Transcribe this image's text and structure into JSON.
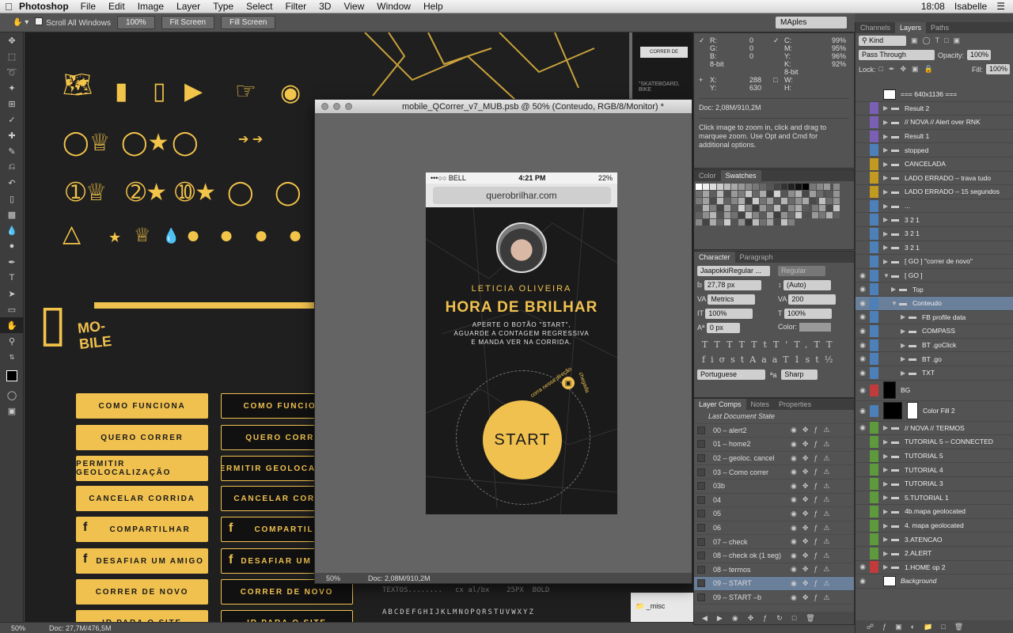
{
  "menubar": {
    "app": "Photoshop",
    "items": [
      "File",
      "Edit",
      "Image",
      "Layer",
      "Type",
      "Select",
      "Filter",
      "3D",
      "View",
      "Window",
      "Help"
    ],
    "time": "18:08",
    "user": "Isabelle"
  },
  "options": {
    "scroll_all": "Scroll All Windows",
    "zoom_btn": "100%",
    "fit_btn": "Fit Screen",
    "fill_btn": "Fill Screen",
    "workspace": "MAples"
  },
  "canvas": {
    "mobile_label": "MO-\nBILE",
    "status_zoom": "50%",
    "status_doc": "Doc: 27,7M/476,5M",
    "buttons_yellow": [
      "COMO FUNCIONA",
      "QUERO CORRER",
      "PERMITIR GEOLOCALIZAÇÃO",
      "CANCELAR CORRIDA",
      "COMPARTILHAR",
      "DESAFIAR UM AMIGO",
      "CORRER DE NOVO",
      "IR PARA O SITE"
    ],
    "buttons_dark": [
      "COMO FUNCIONA",
      "QUERO CORRER",
      "PERMITIR GEOLOCALIZAÇÃO",
      "CANCELAR CORRIDA",
      "COMPARTILHAR",
      "DESAFIAR UM AMIGO",
      "CORRER DE NOVO",
      "IR PARA O SITE"
    ],
    "textos_line": "TEXTOS........   cx al/bx    25PX  BOLD",
    "alphabet": "ABCDEFGHIJKLMNOPQRSTUVWXYZ",
    "thumb_button": "CORRER DE",
    "thumb_caption": "\"SKATEBOARD, BIKE",
    "misc_folder": "_misc"
  },
  "document": {
    "title": "mobile_QCorrer_v7_MUB.psb @ 50% (Conteudo, RGB/8/Monitor) *",
    "zoom": "50%",
    "doc": "Doc: 2,08M/910,2M"
  },
  "phone": {
    "carrier": "•••○○ BELL",
    "time": "4:21 PM",
    "battery": "22%",
    "url": "querobrilhar.com",
    "name": "LETICIA OLIVEIRA",
    "headline": "HORA DE BRILHAR",
    "body": "APERTE O BOTÃO \"START\",\nAGUARDE A CONTAGEM REGRESSIVA\nE MANDA VER NA CORRIDA.",
    "start": "START",
    "arc1": "corra nessa direção",
    "arc2": "chegada"
  },
  "info_panel": {
    "r": "R:",
    "g": "G:",
    "b": "B:",
    "r_val": "0",
    "g_val": "0",
    "b_val": "0",
    "bit": "8-bit",
    "c": "C:",
    "m": "M:",
    "y": "Y:",
    "k": "K:",
    "c_val": "99%",
    "m_val": "95%",
    "y_val": "96%",
    "k_val": "92%",
    "bit2": "8-bit",
    "x": "X:",
    "yy": "Y:",
    "x_val": "288",
    "y_val2": "630",
    "w": "W:",
    "h": "H:",
    "doc": "Doc: 2,08M/910,2M",
    "hint": "Click image to zoom in, click and drag to marquee zoom.  Use Opt and Cmd for additional options."
  },
  "swatches_panel": {
    "tab_color": "Color",
    "tab_swatches": "Swatches"
  },
  "character_panel": {
    "tab_char": "Character",
    "tab_para": "Paragraph",
    "font": "JaapokkiRegular ...",
    "style": "Regular",
    "size": "27,78 px",
    "leading": "(Auto)",
    "kerning": "Metrics",
    "tracking": "200",
    "vscale": "100%",
    "hscale": "100%",
    "baseline": "0 px",
    "color_label": "Color:",
    "lang": "Portuguese",
    "aa": "Sharp"
  },
  "layer_comps": {
    "tabs": [
      "Layer Comps",
      "Notes",
      "Properties"
    ],
    "last_state": "Last Document State",
    "items": [
      "00 – alert2",
      "01 – home2",
      "02 – geoloc. cancel",
      "03 – Como correr",
      "03b",
      "04",
      "05",
      "06",
      "07 – check",
      "08 – check ok (1 seg)",
      "08 – termos",
      "09 – START",
      "09 – START –b"
    ],
    "selected": "09 – START"
  },
  "layers_panel": {
    "tabs": [
      "Channels",
      "Layers",
      "Paths"
    ],
    "kind": "Kind",
    "blend": "Pass Through",
    "opacity_label": "Opacity:",
    "opacity": "100%",
    "lock_label": "Lock:",
    "fill_label": "Fill:",
    "fill": "100%",
    "rows": [
      {
        "name": "=== 640x1136 ===",
        "color": "#535353",
        "type": "thumb"
      },
      {
        "name": "Result 2",
        "color": "#7a5fb5",
        "type": "folder"
      },
      {
        "name": "// NOVA // Alert over RNK",
        "color": "#7a5fb5",
        "type": "folder"
      },
      {
        "name": "Result 1",
        "color": "#7a5fb5",
        "type": "folder"
      },
      {
        "name": "stopped",
        "color": "#4d7fb8",
        "type": "folder"
      },
      {
        "name": "CANCELADA",
        "color": "#c29a1f",
        "type": "folder"
      },
      {
        "name": "LADO ERRADO – trava tudo",
        "color": "#c29a1f",
        "type": "folder"
      },
      {
        "name": "LADO ERRADO – 15 segundos",
        "color": "#c29a1f",
        "type": "folder"
      },
      {
        "name": "...",
        "color": "#4d7fb8",
        "type": "folder"
      },
      {
        "name": "3 2 1",
        "color": "#4d7fb8",
        "type": "folder"
      },
      {
        "name": "3 2 1",
        "color": "#4d7fb8",
        "type": "folder"
      },
      {
        "name": "3 2 1",
        "color": "#4d7fb8",
        "type": "folder"
      },
      {
        "name": "[ GO ] \"correr de novo\"",
        "color": "#4d7fb8",
        "type": "folder"
      },
      {
        "name": "[ GO ]",
        "color": "#4d7fb8",
        "type": "open"
      },
      {
        "name": "Top",
        "color": "#4d7fb8",
        "type": "sub"
      },
      {
        "name": "Conteudo",
        "color": "#4d7fb8",
        "type": "subopen"
      },
      {
        "name": "FB profile data",
        "color": "#4d7fb8",
        "type": "sub2"
      },
      {
        "name": "COMPASS",
        "color": "#4d7fb8",
        "type": "sub2"
      },
      {
        "name": "BT .goClick",
        "color": "#4d7fb8",
        "type": "sub2"
      },
      {
        "name": "BT .go",
        "color": "#4d7fb8",
        "type": "sub2"
      },
      {
        "name": "TXT",
        "color": "#4d7fb8",
        "type": "sub2"
      },
      {
        "name": "BG",
        "color": "#c23b3b",
        "type": "bg"
      },
      {
        "name": "Color Fill 2",
        "color": "#4d7fb8",
        "type": "fill"
      },
      {
        "name": "// NOVA // TERMOS",
        "color": "#5c9a3c",
        "type": "folder"
      },
      {
        "name": "TUTORIAL 5 – CONNECTED",
        "color": "#5c9a3c",
        "type": "folder"
      },
      {
        "name": "TUTORIAL 5",
        "color": "#5c9a3c",
        "type": "folder"
      },
      {
        "name": "TUTORIAL 4",
        "color": "#5c9a3c",
        "type": "folder"
      },
      {
        "name": "TUTORIAL 3",
        "color": "#5c9a3c",
        "type": "folder"
      },
      {
        "name": "5.TUTORIAL 1",
        "color": "#5c9a3c",
        "type": "folder"
      },
      {
        "name": "4b.mapa geolocated",
        "color": "#5c9a3c",
        "type": "folder"
      },
      {
        "name": "4. mapa geolocated",
        "color": "#5c9a3c",
        "type": "folder"
      },
      {
        "name": "3.ATENCAO",
        "color": "#5c9a3c",
        "type": "folder"
      },
      {
        "name": "2.ALERT",
        "color": "#5c9a3c",
        "type": "folder"
      },
      {
        "name": "1.HOME op 2",
        "color": "#c23b3b",
        "type": "folder"
      },
      {
        "name": "Background",
        "color": "#535353",
        "type": "background"
      }
    ],
    "selected": "Conteudo"
  },
  "colors": {
    "accent": "#f0c14f",
    "panel": "#535353",
    "selection": "#6a7f99"
  }
}
